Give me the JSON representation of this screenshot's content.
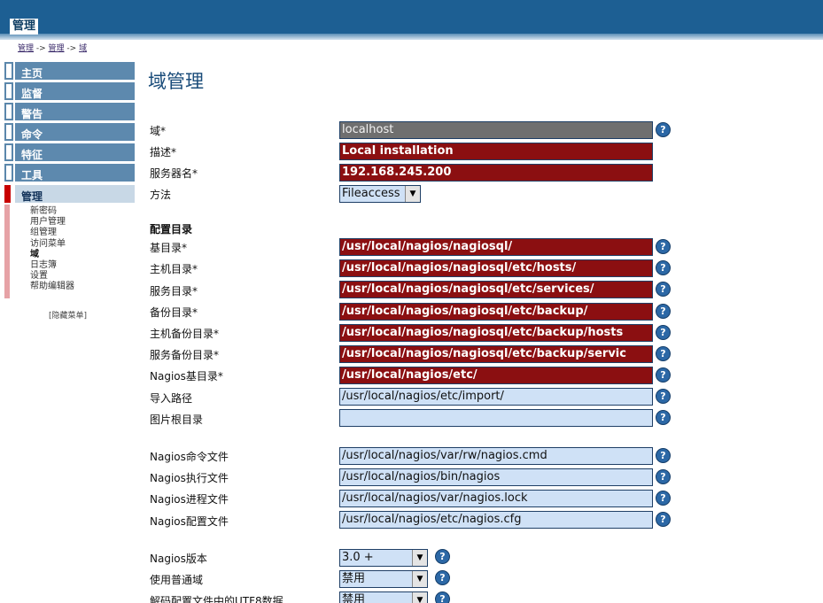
{
  "header": {
    "tab_label": "管理"
  },
  "breadcrumb": {
    "items": [
      "管理",
      "管理",
      "域"
    ],
    "separator": " -> "
  },
  "sidebar": {
    "items": [
      {
        "label": "主页"
      },
      {
        "label": "监督"
      },
      {
        "label": "警告"
      },
      {
        "label": "命令"
      },
      {
        "label": "特征"
      },
      {
        "label": "工具"
      },
      {
        "label": "管理"
      }
    ],
    "submenu": [
      "新密码",
      "用户管理",
      "组管理",
      "访问菜单",
      "域",
      "日志簿",
      "设置",
      "帮助编辑器"
    ],
    "hide_menu": "[隐藏菜单]"
  },
  "main": {
    "title": "域管理",
    "fields": {
      "domain": {
        "label": "域*",
        "value": "localhost"
      },
      "description": {
        "label": "描述*",
        "value": "Local installation"
      },
      "server": {
        "label": "服务器名*",
        "value": "192.168.245.200"
      },
      "method": {
        "label": "方法",
        "value": "Fileaccess"
      }
    },
    "config_section": "配置目录",
    "dirs": [
      {
        "label": "基目录*",
        "value": "/usr/local/nagios/nagiosql/"
      },
      {
        "label": "主机目录*",
        "value": "/usr/local/nagios/nagiosql/etc/hosts/"
      },
      {
        "label": "服务目录*",
        "value": "/usr/local/nagios/nagiosql/etc/services/"
      },
      {
        "label": "备份目录*",
        "value": "/usr/local/nagios/nagiosql/etc/backup/"
      },
      {
        "label": "主机备份目录*",
        "value": "/usr/local/nagios/nagiosql/etc/backup/hosts"
      },
      {
        "label": "服务备份目录*",
        "value": "/usr/local/nagios/nagiosql/etc/backup/servic"
      },
      {
        "label": "Nagios基目录*",
        "value": "/usr/local/nagios/etc/"
      },
      {
        "label": "导入路径",
        "value": "/usr/local/nagios/etc/import/"
      },
      {
        "label": "图片根目录",
        "value": ""
      }
    ],
    "files": [
      {
        "label": "Nagios命令文件",
        "value": "/usr/local/nagios/var/rw/nagios.cmd"
      },
      {
        "label": "Nagios执行文件",
        "value": "/usr/local/nagios/bin/nagios"
      },
      {
        "label": "Nagios进程文件",
        "value": "/usr/local/nagios/var/nagios.lock"
      },
      {
        "label": "Nagios配置文件",
        "value": "/usr/local/nagios/etc/nagios.cfg"
      }
    ],
    "options": [
      {
        "label": "Nagios版本",
        "value": "3.0 +"
      },
      {
        "label": "使用普通域",
        "value": "禁用"
      },
      {
        "label": "解码配置文件中的UTF8数据",
        "value": "禁用"
      }
    ],
    "help_glyph": "?",
    "dropdown_glyph": "▼"
  },
  "colors": {
    "header": "#1d5f93",
    "nav": "#5d89ae",
    "required_field": "#8b0f11",
    "optional_field": "#cfe1f6",
    "readonly_field": "#6f6f6f",
    "help_icon": "#2c68a6"
  }
}
